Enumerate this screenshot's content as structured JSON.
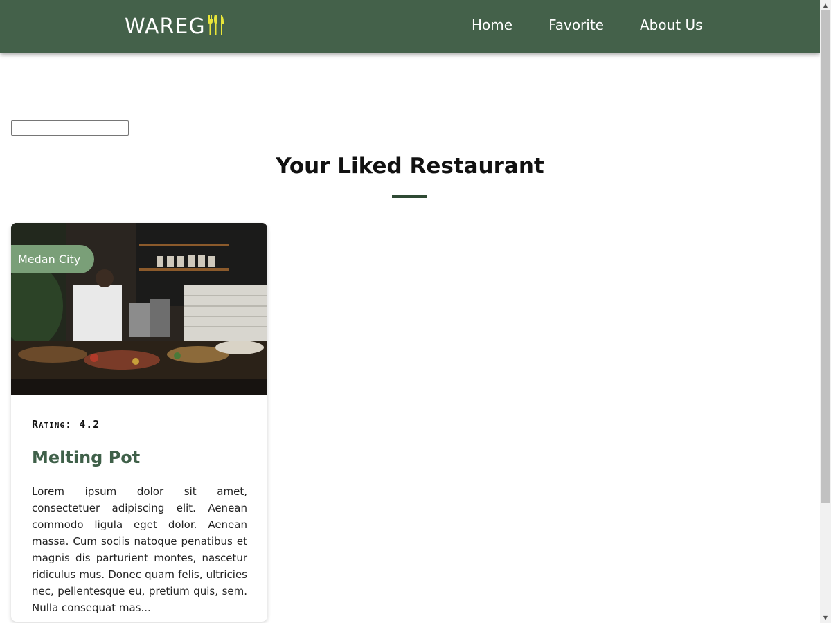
{
  "header": {
    "logo_text": "WAREG",
    "logo_icon": "fork-knife-icon",
    "bg_color": "#44614a",
    "nav": [
      {
        "label": "Home"
      },
      {
        "label": "Favorite"
      },
      {
        "label": "About Us"
      }
    ]
  },
  "search": {
    "value": "",
    "placeholder": ""
  },
  "main": {
    "title": "Your Liked Restaurant",
    "accent_color": "#2f4a34"
  },
  "restaurants": [
    {
      "city": "Medan City",
      "rating_label": "Rating: 4.2",
      "rating": 4.2,
      "name": "Melting Pot",
      "description": "Lorem ipsum dolor sit amet, consectetuer adipiscing elit. Aenean commodo ligula eget dolor. Aenean massa. Cum sociis natoque penatibus et magnis dis parturient montes, nascetur ridiculus mus. Donec quam felis, ultricies nec, pellentesque eu, pretium quis, sem. Nulla consequat mas...",
      "image": "restaurant-kitchen-photo"
    }
  ]
}
